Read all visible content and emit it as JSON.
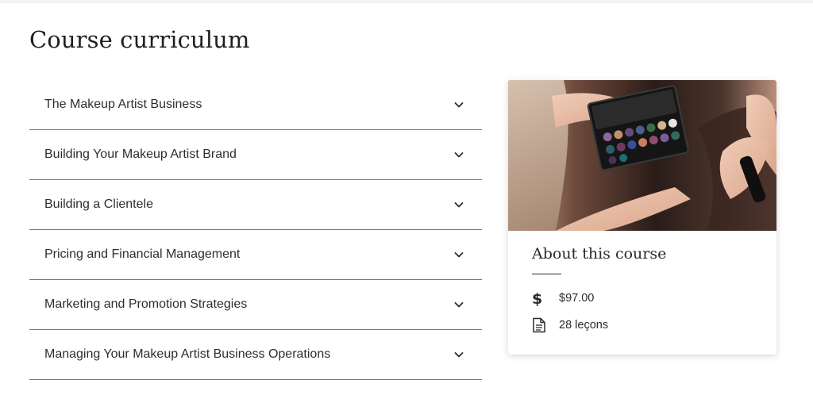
{
  "page": {
    "title": "Course curriculum"
  },
  "curriculum": {
    "modules": [
      {
        "label": "The Makeup Artist Business"
      },
      {
        "label": "Building Your Makeup Artist Brand"
      },
      {
        "label": "Building a Clientele"
      },
      {
        "label": "Pricing and Financial Management"
      },
      {
        "label": "Marketing and Promotion Strategies"
      },
      {
        "label": "Managing Your Makeup Artist Business Operations"
      }
    ],
    "expand_icon": "chevron-down-icon"
  },
  "about": {
    "image_subject": "eyeshadow palette held during makeup application",
    "title": "About this course",
    "price": "$97.00",
    "price_icon": "dollar-icon",
    "lessons": "28 leçons",
    "lessons_icon": "document-icon"
  },
  "colors": {
    "divider": "#7a7a7a",
    "text": "#2b2b2b",
    "background": "#ffffff"
  }
}
